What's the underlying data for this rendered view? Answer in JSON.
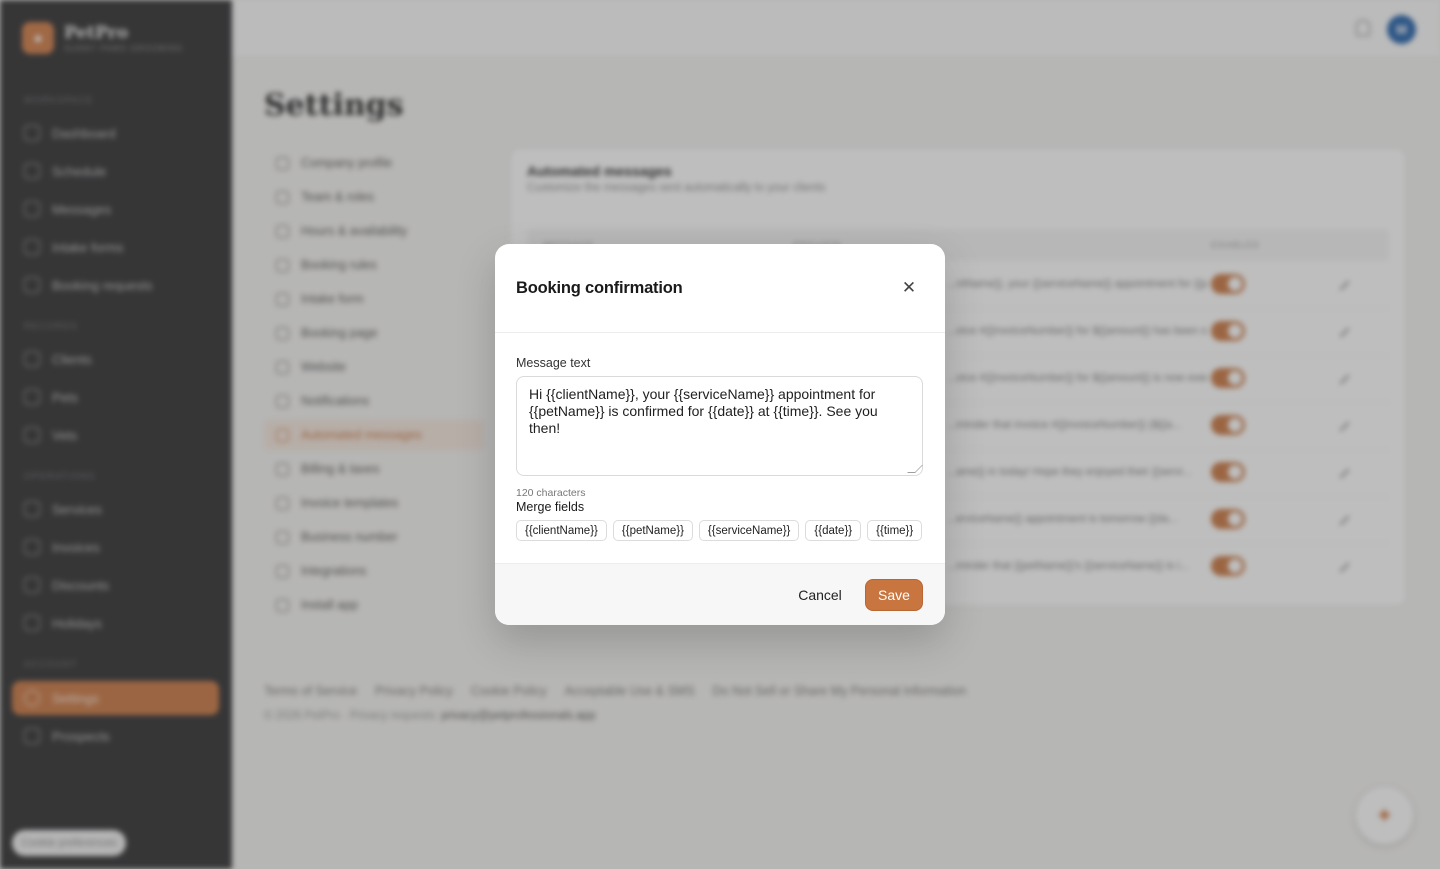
{
  "brand": {
    "name": "PetPro",
    "subtitle": "SUNNY PAWS GROOMING"
  },
  "sidebar": {
    "sections": [
      "WORKSPACE",
      "RECORDS",
      "OPERATIONS",
      "ACCOUNT"
    ],
    "items": [
      {
        "label": "Dashboard",
        "icon": "home-icon"
      },
      {
        "label": "Schedule",
        "icon": "calendar-icon"
      },
      {
        "label": "Messages",
        "icon": "chat-icon"
      },
      {
        "label": "Intake forms",
        "icon": "document-icon"
      },
      {
        "label": "Booking requests",
        "icon": "inbox-icon"
      },
      {
        "label": "Clients",
        "icon": "users-icon"
      },
      {
        "label": "Pets",
        "icon": "paw-icon"
      },
      {
        "label": "Vets",
        "icon": "stethoscope-icon"
      },
      {
        "label": "Services",
        "icon": "star-icon"
      },
      {
        "label": "Invoices",
        "icon": "receipt-icon"
      },
      {
        "label": "Discounts",
        "icon": "tag-icon"
      },
      {
        "label": "Holidays",
        "icon": "flag-icon"
      },
      {
        "label": "Settings",
        "icon": "gear-icon"
      },
      {
        "label": "Prospects",
        "icon": "users-icon"
      }
    ],
    "cookie_label": "Cookie preferences"
  },
  "topbar": {
    "avatar_initial": "M"
  },
  "page": {
    "title": "Settings"
  },
  "settings_nav": [
    {
      "label": "Company profile"
    },
    {
      "label": "Team & roles"
    },
    {
      "label": "Hours & availability"
    },
    {
      "label": "Booking rules"
    },
    {
      "label": "Intake form"
    },
    {
      "label": "Booking page"
    },
    {
      "label": "Website"
    },
    {
      "label": "Notifications"
    },
    {
      "label": "Automated messages"
    },
    {
      "label": "Billing & taxes"
    },
    {
      "label": "Invoice templates"
    },
    {
      "label": "Business number"
    },
    {
      "label": "Integrations"
    },
    {
      "label": "Install app"
    }
  ],
  "card": {
    "title": "Automated messages",
    "subtitle": "Customize the messages sent automatically to your clients",
    "columns": [
      "MESSAGE",
      "PREVIEW",
      "ENABLED"
    ],
    "rows": [
      {
        "preview": "...ntName}}, your {{serviceName}} appointment for {{petName}} is c..."
      },
      {
        "preview": "...oice #{{invoiceNumber}} for ${{amount}} has been s..."
      },
      {
        "preview": "...oice #{{invoiceNumber}} for ${{amount}} is now over..."
      },
      {
        "preview": "...minder that invoice #{{invoiceNumber}} (${{a..."
      },
      {
        "preview": "...ame}} in today! Hope they enjoyed their {{servi..."
      },
      {
        "preview": "...erviceName}} appointment is tomorrow {{da..."
      },
      {
        "preview": "...minder that {{petName}}'s {{serviceName}} is i..."
      }
    ]
  },
  "footer": {
    "links": [
      "Terms of Service",
      "Privacy Policy",
      "Cookie Policy",
      "Acceptable Use & SMS",
      "Do Not Sell or Share My Personal Information"
    ],
    "copyright": "© 2026 PetPro · Privacy requests:",
    "email": "privacy@petprofessionals.app"
  },
  "modal": {
    "title": "Booking confirmation",
    "message_label": "Message text",
    "message_value": "Hi {{clientName}}, your {{serviceName}} appointment for {{petName}} is confirmed for {{date}} at {{time}}. See you then!",
    "char_count": "120 characters",
    "merge_title": "Merge fields",
    "merge_fields": [
      "{{clientName}}",
      "{{petName}}",
      "{{serviceName}}",
      "{{date}}",
      "{{time}}"
    ],
    "cancel_label": "Cancel",
    "save_label": "Save"
  },
  "colors": {
    "accent": "#c9753f",
    "sidebar_bg": "#2b2b2d",
    "avatar": "#1f5ea8"
  }
}
